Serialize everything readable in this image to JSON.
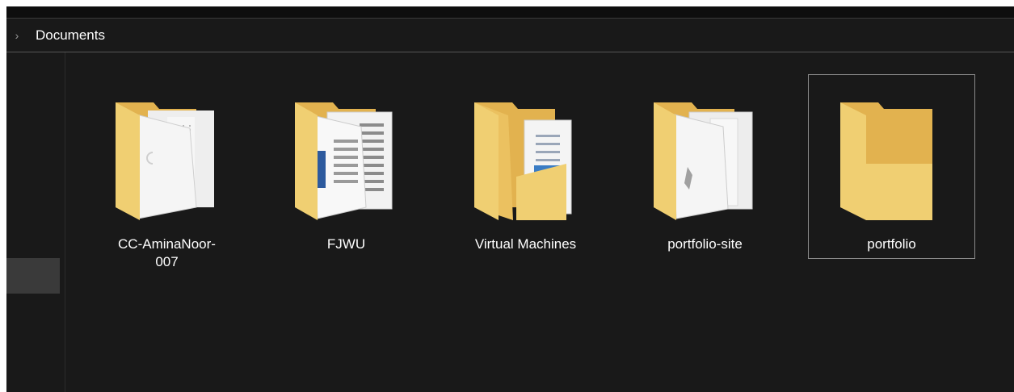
{
  "address_bar": {
    "chevron": "›",
    "current": "Documents"
  },
  "folders": [
    {
      "name": "CC-AminaNoor-\n007",
      "icon": "folder-with-documents-icon",
      "selected": false
    },
    {
      "name": "FJWU",
      "icon": "folder-with-documents-icon",
      "selected": false
    },
    {
      "name": "Virtual Machines",
      "icon": "folder-with-image-icon",
      "selected": false
    },
    {
      "name": "portfolio-site",
      "icon": "folder-with-documents-icon",
      "selected": false
    },
    {
      "name": "portfolio",
      "icon": "empty-folder-icon",
      "selected": true
    }
  ],
  "colors": {
    "background": "#191919",
    "folder": "#f0cf72",
    "folder_back": "#e2b24f",
    "selection_border": "#8a8a8a"
  }
}
